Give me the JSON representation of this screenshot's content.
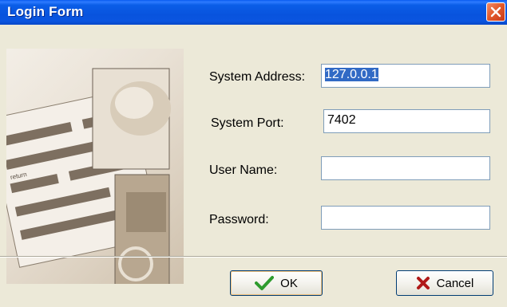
{
  "window": {
    "title": "Login Form"
  },
  "form": {
    "system_address": {
      "label": "System Address:",
      "value": "127.0.0.1"
    },
    "system_port": {
      "label": "System Port:",
      "value": "7402"
    },
    "user_name": {
      "label": "User Name:",
      "value": ""
    },
    "password": {
      "label": "Password:",
      "value": ""
    }
  },
  "side_image": {
    "stamp_text": "return"
  },
  "buttons": {
    "ok_label": "OK",
    "cancel_label": "Cancel"
  },
  "icons": {
    "ok": "checkmark-icon",
    "cancel": "x-icon",
    "close": "close-icon"
  },
  "colors": {
    "titlebar": "#0a55e0",
    "close": "#e35b2c",
    "selection": "#316ac5",
    "ok_check": "#2e9b2e",
    "cancel_x": "#b01919"
  }
}
